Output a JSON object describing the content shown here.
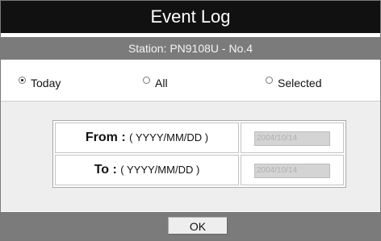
{
  "title": "Event Log",
  "station": "Station: PN9108U - No.4",
  "filter_options": [
    {
      "label": "Today",
      "checked": true
    },
    {
      "label": "All",
      "checked": false
    },
    {
      "label": "Selected",
      "checked": false
    }
  ],
  "date_range": {
    "from": {
      "label": "From :",
      "hint": "( YYYY/MM/DD )",
      "value": "2004/10/14"
    },
    "to": {
      "label": "To :",
      "hint": "( YYYY/MM/DD )",
      "value": "2004/10/14"
    }
  },
  "ok_label": "OK",
  "colors": {
    "title_bar": "#111111",
    "station_bar": "#7b7b7b",
    "body_background": "#eeeeee",
    "footer_bar": "#7b7b7b"
  }
}
